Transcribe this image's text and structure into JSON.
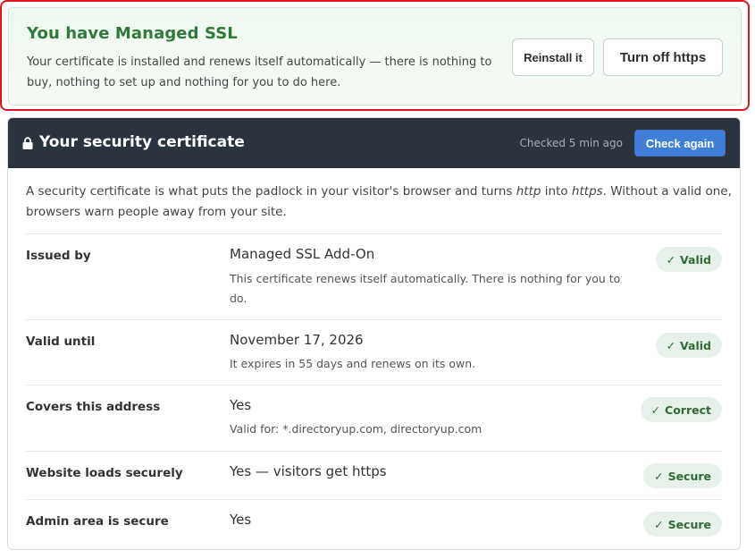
{
  "banner": {
    "title": "You have Managed SSL",
    "description": "Your certificate is installed and renews itself automatically — there is nothing to buy, nothing to set up and nothing for you to do here.",
    "reinstall_label": "Reinstall it",
    "turn_off_label": "Turn off https"
  },
  "card": {
    "title": "Your security certificate",
    "checked": "Checked 5 min ago",
    "check_again_label": "Check again",
    "intro_part1": "A security certificate is what puts the padlock in your visitor's browser and turns ",
    "intro_http": "http",
    "intro_part2": " into ",
    "intro_https": "https",
    "intro_part3": ". Without a valid one, browsers warn people away from your site.",
    "rows": [
      {
        "label": "Issued by",
        "value": "Managed SSL Add-On",
        "note": "This certificate renews itself automatically. There is nothing for you to do.",
        "badge": "Valid"
      },
      {
        "label": "Valid until",
        "value": "November 17, 2026",
        "note": "It expires in 55 days and renews on its own.",
        "badge": "Valid"
      },
      {
        "label": "Covers this address",
        "value": "Yes",
        "note": "Valid for: *.directoryup.com, directoryup.com",
        "badge": "Correct"
      },
      {
        "label": "Website loads securely",
        "value": "Yes — visitors get https",
        "note": "",
        "badge": "Secure"
      },
      {
        "label": "Admin area is secure",
        "value": "Yes",
        "note": "",
        "badge": "Secure"
      }
    ]
  },
  "icons": {
    "lock": "lock-icon",
    "check": "✓"
  },
  "colors": {
    "success_green": "#2f7a3a",
    "header_dark": "#2b333f",
    "primary_blue": "#3f7fd8",
    "highlight_red": "#e0141e"
  }
}
